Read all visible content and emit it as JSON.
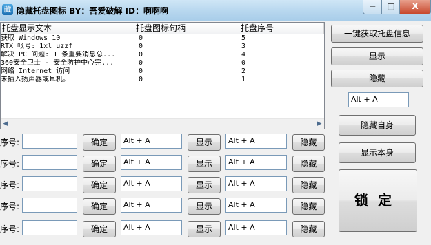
{
  "window": {
    "title": "隐藏托盘图标 BY：吾爱破解 ID：啊啊啊",
    "minimize": "─",
    "maximize": "□",
    "close": "X"
  },
  "table": {
    "columns": [
      "托盘显示文本",
      "托盘图标句柄",
      "托盘序号"
    ],
    "rows": [
      {
        "text": "获取 Windows 10",
        "handle": "0",
        "index": "5"
      },
      {
        "text": "RTX 帐号: 1xl_uzzf",
        "handle": "0",
        "index": "3"
      },
      {
        "text": "解决 PC 问题: 1 条重要消息总...",
        "handle": "0",
        "index": "4"
      },
      {
        "text": "360安全卫士 - 安全防护中心完...",
        "handle": "0",
        "index": "0"
      },
      {
        "text": "网络 Internet 访问",
        "handle": "0",
        "index": "2"
      },
      {
        "text": "未插入扬声器或耳机。",
        "handle": "0",
        "index": "1"
      }
    ],
    "scroll_left": "◀",
    "scroll_right": "▶"
  },
  "rows": [
    {
      "label": "序号:",
      "index_value": "",
      "confirm": "确定",
      "hotkey_show": "Alt + A",
      "show": "显示",
      "hotkey_hide": "Alt + A",
      "hide": "隐藏"
    },
    {
      "label": "序号:",
      "index_value": "",
      "confirm": "确定",
      "hotkey_show": "Alt + A",
      "show": "显示",
      "hotkey_hide": "Alt + A",
      "hide": "隐藏"
    },
    {
      "label": "序号:",
      "index_value": "",
      "confirm": "确定",
      "hotkey_show": "Alt + A",
      "show": "显示",
      "hotkey_hide": "Alt + A",
      "hide": "隐藏"
    },
    {
      "label": "序号:",
      "index_value": "",
      "confirm": "确定",
      "hotkey_show": "Alt + A",
      "show": "显示",
      "hotkey_hide": "Alt + A",
      "hide": "隐藏"
    },
    {
      "label": "序号:",
      "index_value": "",
      "confirm": "确定",
      "hotkey_show": "Alt + A",
      "show": "显示",
      "hotkey_hide": "Alt + A",
      "hide": "隐藏"
    }
  ],
  "side": {
    "get_info": "一键获取托盘信息",
    "show": "显示",
    "hide": "隐藏",
    "hotkey": "Alt + A",
    "hide_self": "隐藏自身",
    "show_self": "显示本身",
    "lock": "锁定"
  },
  "icons": {
    "app": "app-icon"
  },
  "colors": {
    "titlebar": "#b9d8ef",
    "close_button": "#c7472c",
    "input_border": "#7a9ab8"
  }
}
